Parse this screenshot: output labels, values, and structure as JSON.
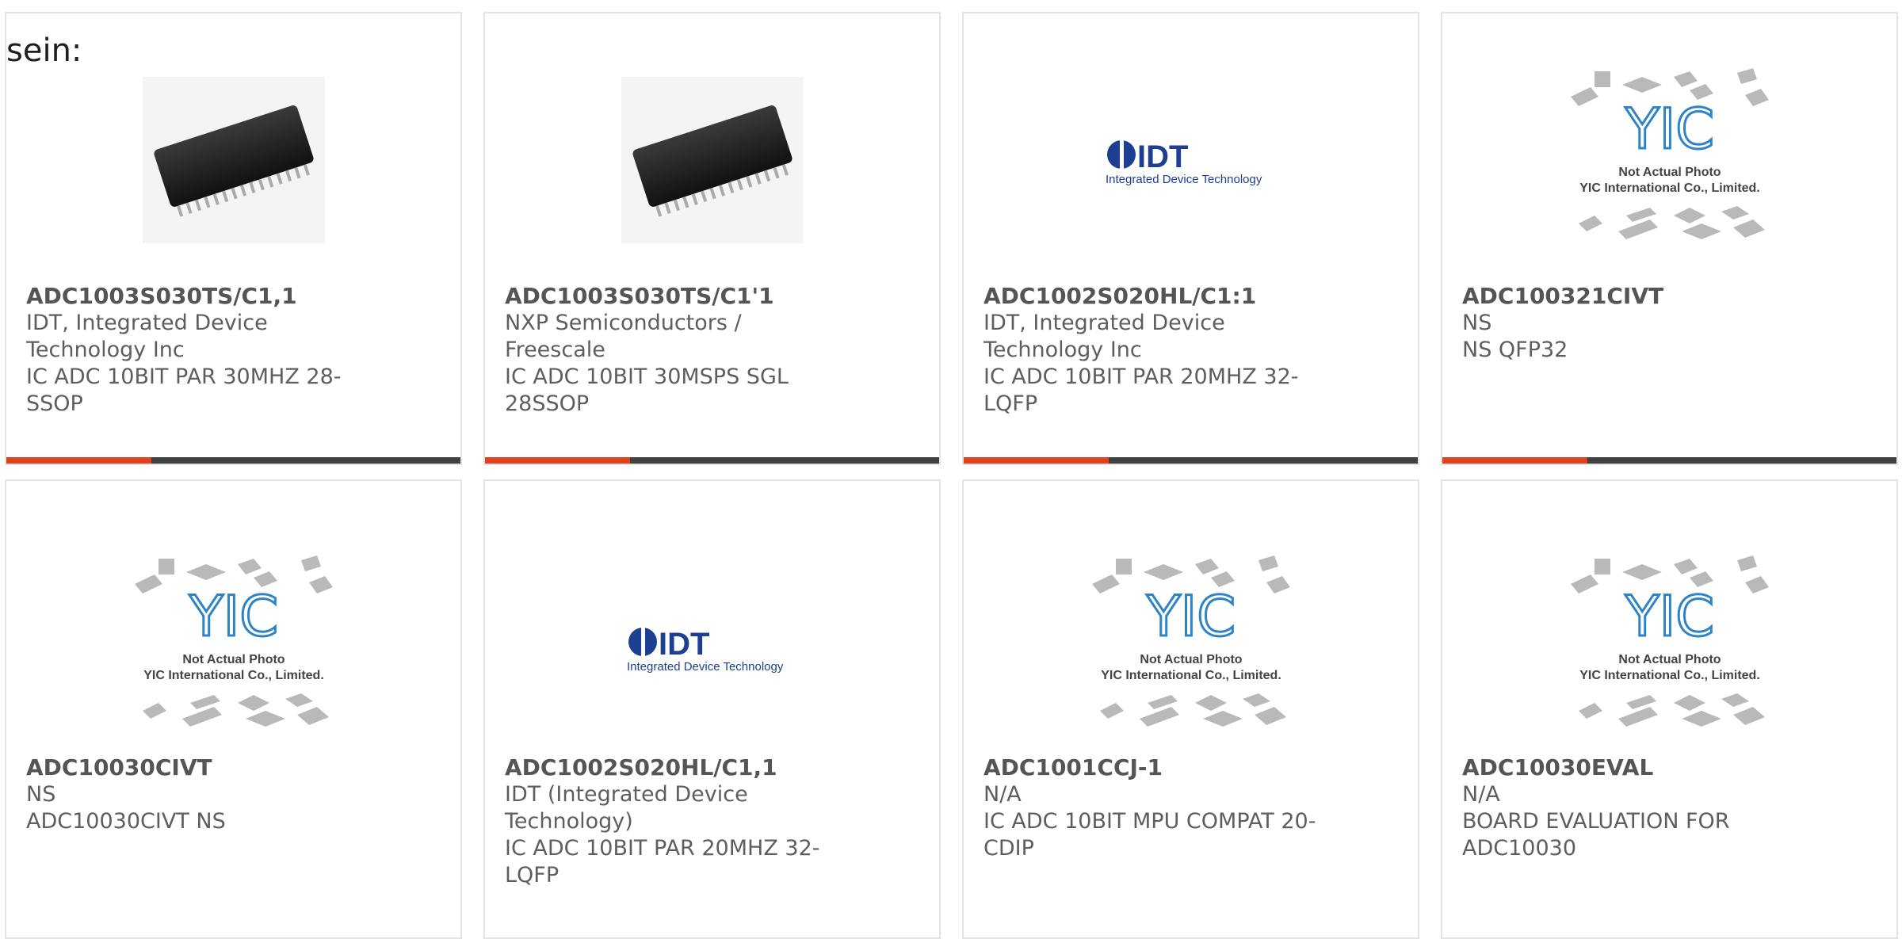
{
  "lead_text": "sein:",
  "colors": {
    "accent": "#e2401b",
    "bar_dark": "#404040",
    "text": "#5e5e5e",
    "idt_blue": "#1c3f94",
    "yic_blue": "#2e84c6"
  },
  "products": [
    {
      "part": "ADC1003S030TS/C1,1",
      "manufacturer": "IDT, Integrated Device Technology Inc",
      "description": "IC ADC 10BIT PAR 30MHZ 28-SSOP",
      "image": "chip-ssop-photo"
    },
    {
      "part": "ADC1003S030TS/C1'1",
      "manufacturer": "NXP Semiconductors / Freescale",
      "description": "IC ADC 10BIT 30MSPS SGL 28SSOP",
      "image": "chip-ssop-photo"
    },
    {
      "part": "ADC1002S020HL/C1:1",
      "manufacturer": "IDT, Integrated Device Technology Inc",
      "description": "IC ADC 10BIT PAR 20MHZ 32-LQFP",
      "image": "idt-logo"
    },
    {
      "part": "ADC100321CIVT",
      "manufacturer": "NS",
      "description": "NS QFP32",
      "image": "yic-placeholder"
    },
    {
      "part": "ADC10030CIVT",
      "manufacturer": "NS",
      "description": "ADC10030CIVT NS",
      "image": "yic-placeholder"
    },
    {
      "part": "ADC1002S020HL/C1,1",
      "manufacturer": "IDT (Integrated Device Technology)",
      "description": "IC ADC 10BIT PAR 20MHZ 32-LQFP",
      "image": "idt-logo"
    },
    {
      "part": "ADC1001CCJ-1",
      "manufacturer": "N/A",
      "description": "IC ADC 10BIT MPU COMPAT 20-CDIP",
      "image": "yic-placeholder"
    },
    {
      "part": "ADC10030EVAL",
      "manufacturer": "N/A",
      "description": "BOARD EVALUATION FOR ADC10030",
      "image": "yic-placeholder"
    }
  ],
  "logo_text": {
    "idt_brand": "IDT",
    "idt_sub": "Integrated Device Technology",
    "yic_brand": "YIC",
    "yic_line1": "Not Actual Photo",
    "yic_line2": "YIC International Co., Limited."
  }
}
